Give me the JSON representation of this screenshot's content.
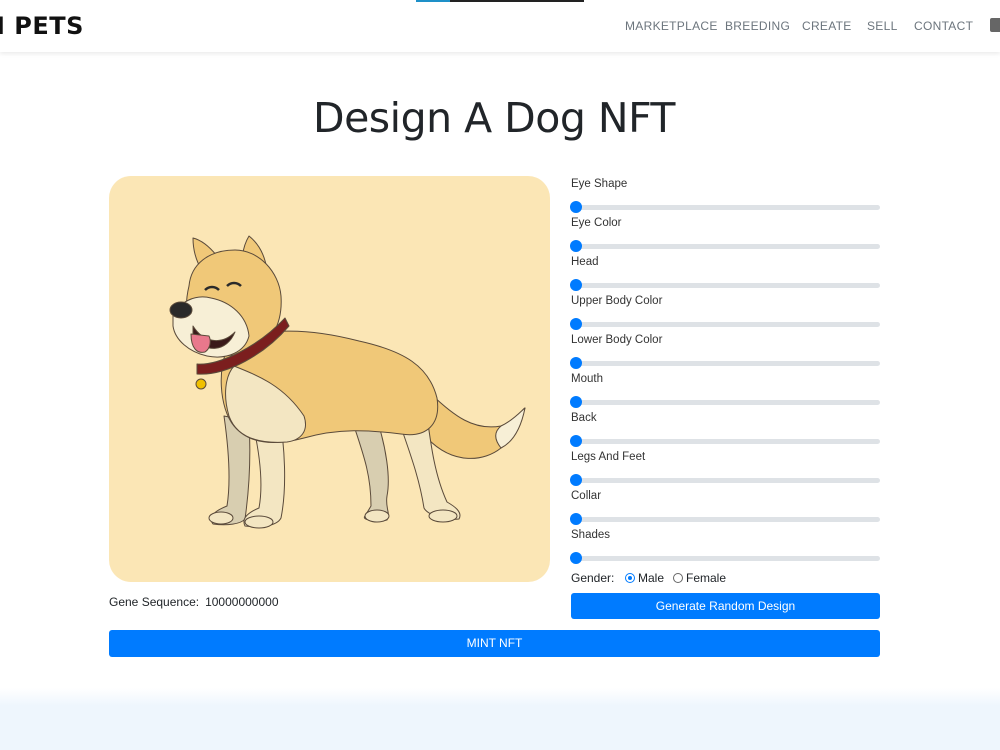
{
  "brand": "I PETS",
  "nav": [
    {
      "label": "MARKETPLACE"
    },
    {
      "label": "BREEDING"
    },
    {
      "label": "CREATE"
    },
    {
      "label": "SELL"
    },
    {
      "label": "CONTACT"
    }
  ],
  "page_title": "Design A Dog NFT",
  "traits": [
    {
      "label": "Eye Shape",
      "value": 0
    },
    {
      "label": "Eye Color",
      "value": 0
    },
    {
      "label": "Head",
      "value": 0
    },
    {
      "label": "Upper Body Color",
      "value": 0
    },
    {
      "label": "Lower Body Color",
      "value": 0
    },
    {
      "label": "Mouth",
      "value": 0
    },
    {
      "label": "Back",
      "value": 0
    },
    {
      "label": "Legs And Feet",
      "value": 0
    },
    {
      "label": "Collar",
      "value": 0
    },
    {
      "label": "Shades",
      "value": 0
    }
  ],
  "gender": {
    "label": "Gender:",
    "options": [
      {
        "label": "Male",
        "selected": true
      },
      {
        "label": "Female",
        "selected": false
      }
    ]
  },
  "gene": {
    "label": "Gene Sequence:",
    "value": "10000000000"
  },
  "buttons": {
    "random": "Generate Random Design",
    "mint": "MINT NFT"
  },
  "colors": {
    "accent": "#007bff",
    "card_background": "#fbe6b5",
    "dog_fur": "#f0c878",
    "dog_underside": "#f3e6c2",
    "collar": "#7b1e1e"
  }
}
